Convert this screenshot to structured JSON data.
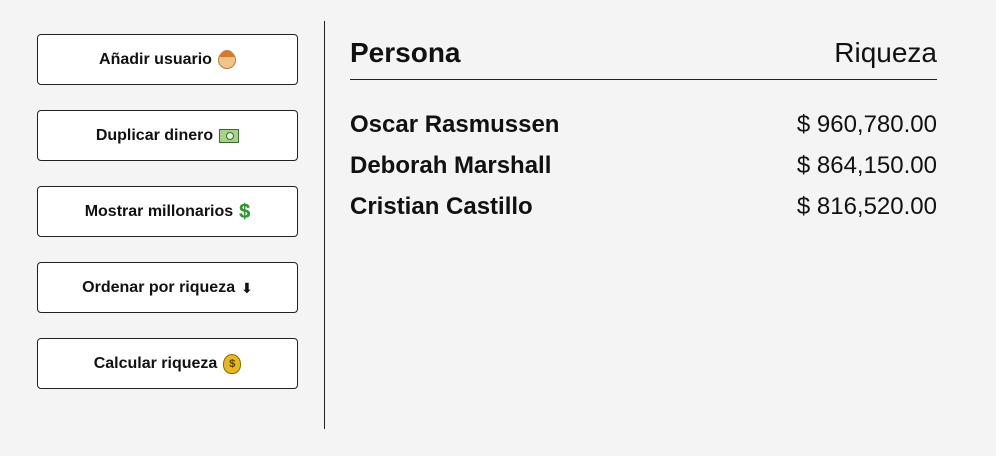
{
  "sidebar": {
    "buttons": [
      {
        "label": "Añadir usuario",
        "icon": "person-icon"
      },
      {
        "label": "Duplicar dinero",
        "icon": "banknote-icon"
      },
      {
        "label": "Mostrar millonarios",
        "icon": "dollar-sign-icon"
      },
      {
        "label": "Ordenar por riqueza",
        "icon": "arrow-down-icon"
      },
      {
        "label": "Calcular riqueza",
        "icon": "money-bag-icon"
      }
    ]
  },
  "main": {
    "header": {
      "person": "Persona",
      "wealth": "Riqueza"
    },
    "rows": [
      {
        "name": "Oscar Rasmussen",
        "amount": "$ 960,780.00"
      },
      {
        "name": "Deborah Marshall",
        "amount": "$ 864,150.00"
      },
      {
        "name": "Cristian Castillo",
        "amount": "$ 816,520.00"
      }
    ]
  },
  "colors": {
    "background": "#f4f4f4",
    "button_bg": "#ffffff",
    "border": "#222222"
  }
}
